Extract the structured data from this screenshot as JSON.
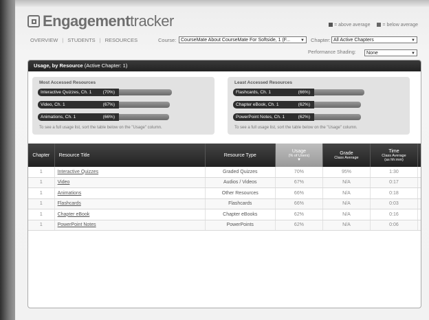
{
  "app": {
    "logo_text": "Engagementtracker",
    "logo_prefix": "Engagement",
    "logo_suffix": "tracker"
  },
  "legend": {
    "above": "= above average",
    "below": "= below average",
    "above_color": "#555555",
    "below_color": "#666666"
  },
  "nav": {
    "items": [
      "OVERVIEW",
      "STUDENTS",
      "RESOURCES"
    ]
  },
  "filters": {
    "course_label": "Course:",
    "course_value": "CourseMate About CourseMate For Softside, 1 (F...",
    "chapter_label": "Chapter:",
    "chapter_value": "All Active Chapters",
    "shading_label": "Performance Shading:",
    "shading_value": "None"
  },
  "panel": {
    "title": "Usage, by Resource",
    "subtitle": "(Active Chapter: 1)"
  },
  "most_accessed": {
    "title": "Most Accessed Resources",
    "items": [
      {
        "label": "Interactive Quizzes, Ch. 1",
        "pct": "(70%)",
        "value": 70
      },
      {
        "label": "Video, Ch. 1",
        "pct": "(67%)",
        "value": 67
      },
      {
        "label": "Animations, Ch. 1",
        "pct": "(66%)",
        "value": 66
      }
    ],
    "note": "To see a full usage list, sort the table below on the \"Usage\" column."
  },
  "least_accessed": {
    "title": "Least Accessed Resources",
    "items": [
      {
        "label": "Flashcards, Ch. 1",
        "pct": "(66%)",
        "value": 66
      },
      {
        "label": "Chapter eBook, Ch. 1",
        "pct": "(62%)",
        "value": 62
      },
      {
        "label": "PowerPoint Notes, Ch. 1",
        "pct": "(62%)",
        "value": 62
      }
    ],
    "note": "To see a full usage list, sort the table below on the \"Usage\" column."
  },
  "table": {
    "headers": {
      "chapter": "Chapter",
      "title": "Resource Title",
      "type": "Resource Type",
      "usage": "Usage",
      "usage_sub": "(% of Users)",
      "grade": "Grade",
      "grade_sub": "Class Average",
      "time": "Time",
      "time_sub1": "Class Average",
      "time_sub2": "(as hh:mm)"
    },
    "rows": [
      {
        "chapter": "1",
        "title": "Interactive Quizzes",
        "type": "Graded Quizzes",
        "usage": "70%",
        "grade": "95%",
        "time": "1:30"
      },
      {
        "chapter": "1",
        "title": "Video",
        "type": "Audios / Videos",
        "usage": "67%",
        "grade": "N/A",
        "time": "0:17"
      },
      {
        "chapter": "1",
        "title": "Animations",
        "type": "Other Resources",
        "usage": "66%",
        "grade": "N/A",
        "time": "0:18"
      },
      {
        "chapter": "1",
        "title": "Flashcards",
        "type": "Flashcards",
        "usage": "66%",
        "grade": "N/A",
        "time": "0:03"
      },
      {
        "chapter": "1",
        "title": "Chapter eBook",
        "type": "Chapter eBooks",
        "usage": "62%",
        "grade": "N/A",
        "time": "0:16"
      },
      {
        "chapter": "1",
        "title": "PowerPoint Notes",
        "type": "PowerPoints",
        "usage": "62%",
        "grade": "N/A",
        "time": "0:06"
      }
    ]
  }
}
